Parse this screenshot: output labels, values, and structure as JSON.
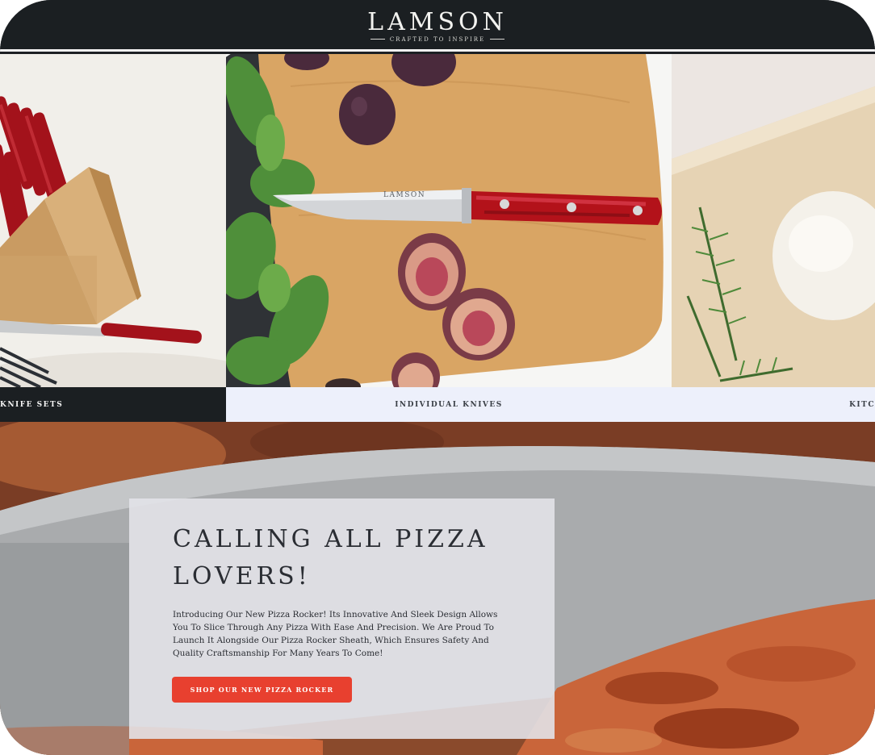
{
  "header": {
    "logo_text": "LAMSON",
    "tagline": "CRAFTED TO INSPIRE"
  },
  "categories": [
    {
      "label": "KNIFE SETS"
    },
    {
      "label": "INDIVIDUAL KNIVES"
    },
    {
      "label": "KITC"
    }
  ],
  "knife_blade_engraving": "LAMSON",
  "hero": {
    "title": "CALLING ALL PIZZA LOVERS!",
    "body": "Introducing Our New Pizza Rocker! Its Innovative And Sleek Design Allows You To Slice Through Any Pizza With Ease And Precision. We Are Proud To Launch It Alongside Our Pizza Rocker Sheath, Which Ensures Safety And Quality Craftsmanship For Many Years To Come!",
    "cta_label": "SHOP OUR NEW PIZZA ROCKER"
  },
  "colors": {
    "header_bg": "#1b1f22",
    "cta_bg": "#e8402f",
    "caption_light_bg": "#edf0fb",
    "handle_red": "#b3121a"
  }
}
